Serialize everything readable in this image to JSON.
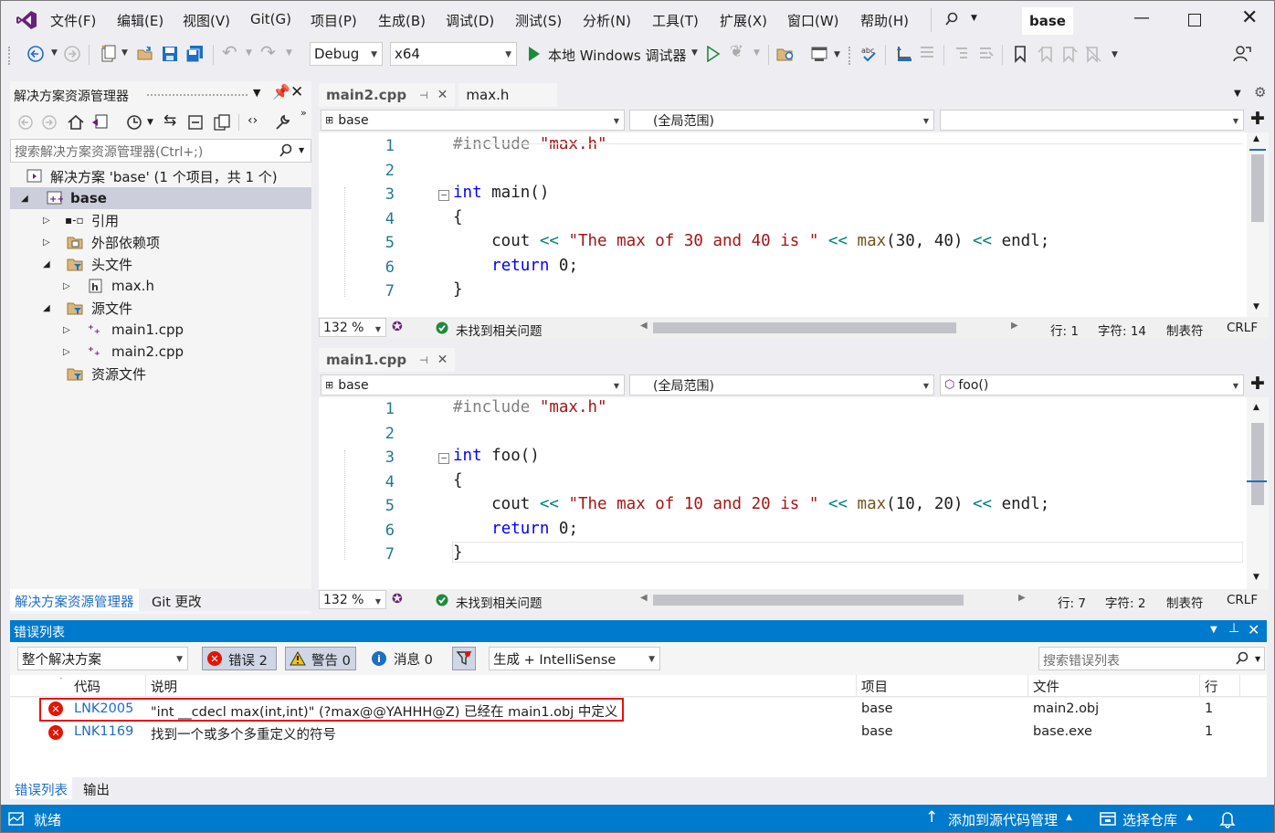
{
  "menu": {
    "items": [
      "文件(F)",
      "编辑(E)",
      "视图(V)",
      "Git(G)",
      "项目(P)",
      "生成(B)",
      "调试(D)",
      "测试(S)",
      "分析(N)",
      "工具(T)",
      "扩展(X)",
      "窗口(W)",
      "帮助(H)"
    ],
    "solution_badge": "base"
  },
  "toolbar": {
    "config": "Debug",
    "platform": "x64",
    "run_label": "本地 Windows 调试器"
  },
  "solution_explorer": {
    "title": "解决方案资源管理器",
    "search_placeholder": "搜索解决方案资源管理器(Ctrl+;)",
    "tree": [
      {
        "label": "解决方案 'base' (1 个项目，共 1 个)"
      },
      {
        "label": "base"
      },
      {
        "label": "引用"
      },
      {
        "label": "外部依赖项"
      },
      {
        "label": "头文件"
      },
      {
        "label": "max.h"
      },
      {
        "label": "源文件"
      },
      {
        "label": "main1.cpp"
      },
      {
        "label": "main2.cpp"
      },
      {
        "label": "资源文件"
      }
    ],
    "bottom_tabs": [
      "解决方案资源管理器",
      "Git 更改"
    ]
  },
  "editor_top": {
    "tabs": [
      "main2.cpp",
      "max.h"
    ],
    "nav": {
      "project": "base",
      "scope": "(全局范围)",
      "member": ""
    },
    "lines": [
      {
        "n": "1",
        "parts": [
          {
            "c": "pp",
            "t": "#include "
          },
          {
            "c": "str",
            "t": "\"max.h\""
          }
        ]
      },
      {
        "n": "2",
        "parts": []
      },
      {
        "n": "3",
        "parts": [
          {
            "c": "kw",
            "t": "int"
          },
          {
            "c": "",
            "t": " main()"
          }
        ]
      },
      {
        "n": "4",
        "parts": [
          {
            "c": "",
            "t": "{"
          }
        ]
      },
      {
        "n": "5",
        "parts": [
          {
            "c": "",
            "t": "    cout "
          },
          {
            "c": "op",
            "t": "<<"
          },
          {
            "c": "str",
            "t": " \"The max of 30 and 40 is \" "
          },
          {
            "c": "op",
            "t": "<<"
          },
          {
            "c": "fn",
            "t": " max"
          },
          {
            "c": "",
            "t": "(30, 40) "
          },
          {
            "c": "op",
            "t": "<<"
          },
          {
            "c": "",
            "t": " endl;"
          }
        ]
      },
      {
        "n": "6",
        "parts": [
          {
            "c": "",
            "t": "    "
          },
          {
            "c": "kw",
            "t": "return"
          },
          {
            "c": "",
            "t": " 0;"
          }
        ]
      },
      {
        "n": "7",
        "parts": [
          {
            "c": "",
            "t": "}"
          }
        ]
      }
    ],
    "status": {
      "zoom": "132 %",
      "issues": "未找到相关问题",
      "line": "行: 1",
      "char": "字符: 14",
      "tabs": "制表符",
      "eol": "CRLF"
    }
  },
  "editor_bottom": {
    "tabs": [
      "main1.cpp"
    ],
    "nav": {
      "project": "base",
      "scope": "(全局范围)",
      "member": "foo()"
    },
    "lines": [
      {
        "n": "1",
        "parts": [
          {
            "c": "pp",
            "t": "#include "
          },
          {
            "c": "str",
            "t": "\"max.h\""
          }
        ]
      },
      {
        "n": "2",
        "parts": []
      },
      {
        "n": "3",
        "parts": [
          {
            "c": "kw",
            "t": "int"
          },
          {
            "c": "",
            "t": " foo()"
          }
        ]
      },
      {
        "n": "4",
        "parts": [
          {
            "c": "",
            "t": "{"
          }
        ]
      },
      {
        "n": "5",
        "parts": [
          {
            "c": "",
            "t": "    cout "
          },
          {
            "c": "op",
            "t": "<<"
          },
          {
            "c": "str",
            "t": " \"The max of 10 and 20 is \" "
          },
          {
            "c": "op",
            "t": "<<"
          },
          {
            "c": "fn",
            "t": " max"
          },
          {
            "c": "",
            "t": "(10, 20) "
          },
          {
            "c": "op",
            "t": "<<"
          },
          {
            "c": "",
            "t": " endl;"
          }
        ]
      },
      {
        "n": "6",
        "parts": [
          {
            "c": "",
            "t": "    "
          },
          {
            "c": "kw",
            "t": "return"
          },
          {
            "c": "",
            "t": " 0;"
          }
        ]
      },
      {
        "n": "7",
        "parts": [
          {
            "c": "",
            "t": "}"
          }
        ]
      }
    ],
    "status": {
      "zoom": "132 %",
      "issues": "未找到相关问题",
      "line": "行: 7",
      "char": "字符: 2",
      "tabs": "制表符",
      "eol": "CRLF"
    }
  },
  "error_list": {
    "title": "错误列表",
    "scope": "整个解决方案",
    "errors_btn": "错误 2",
    "warnings_btn": "警告 0",
    "messages_btn": "消息 0",
    "source": "生成 + IntelliSense",
    "search_placeholder": "搜索错误列表",
    "columns": [
      "代码",
      "说明",
      "项目",
      "文件",
      "行"
    ],
    "rows": [
      {
        "code": "LNK2005",
        "desc": "\"int __cdecl max(int,int)\" (?max@@YAHHH@Z) 已经在 main1.obj 中定义",
        "project": "base",
        "file": "main2.obj",
        "line": "1"
      },
      {
        "code": "LNK1169",
        "desc": "找到一个或多个多重定义的符号",
        "project": "base",
        "file": "base.exe",
        "line": "1"
      }
    ],
    "bottom_tabs": [
      "错误列表",
      "输出"
    ]
  },
  "statusbar": {
    "ready": "就绪",
    "add_source": "添加到源代码管理",
    "select_repo": "选择仓库"
  },
  "colors": {
    "accent": "#007acc",
    "highlight_border": "#e51400",
    "vs_purple": "#68217a"
  }
}
